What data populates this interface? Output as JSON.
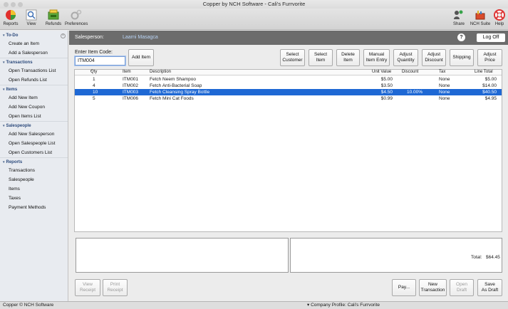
{
  "window": {
    "title": "Copper by NCH Software - Cali's Furrvorite"
  },
  "toolbar": {
    "reports": "Reports",
    "view": "View",
    "refunds": "Refunds",
    "preferences": "Preferences",
    "share": "Share",
    "nch_suite": "NCH Suite",
    "help": "Help"
  },
  "sidebar": {
    "sections": [
      {
        "title": "To-Do",
        "items": [
          "Create an Item",
          "Add a Salesperson"
        ]
      },
      {
        "title": "Transactions",
        "items": [
          "Open Transactions List",
          "Open Refunds List"
        ]
      },
      {
        "title": "Items",
        "items": [
          "Add New Item",
          "Add New Coupon",
          "Open Items List"
        ]
      },
      {
        "title": "Salespeople",
        "items": [
          "Add New Salesperson",
          "Open Salespeople List",
          "Open Customers List"
        ]
      },
      {
        "title": "Reports",
        "items": [
          "Transactions",
          "Salespeople",
          "Items",
          "Taxes",
          "Payment Methods"
        ]
      }
    ]
  },
  "header": {
    "salesperson_label": "Salesperson:",
    "salesperson_name": "Laarni Masagca",
    "help": "?",
    "log_off": "Log Off"
  },
  "entry": {
    "label": "Enter Item Code:",
    "value": "ITM004",
    "add_item": "Add Item"
  },
  "actions": {
    "select_customer": [
      "Select",
      "Customer"
    ],
    "select_item": [
      "Select",
      "Item"
    ],
    "delete_item": [
      "Delete",
      "Item"
    ],
    "manual_entry": [
      "Manual",
      "Item Entry"
    ],
    "adjust_quantity": [
      "Adjust",
      "Quantity"
    ],
    "adjust_discount": [
      "Adjust",
      "Discount"
    ],
    "shipping": "Shipping",
    "adjust_price": [
      "Adjust",
      "Price"
    ]
  },
  "table": {
    "columns": [
      "Qty",
      "Item",
      "Description",
      "Unit Value",
      "Discount",
      "Tax",
      "Line Total"
    ],
    "sort_indicator": "^",
    "rows": [
      {
        "qty": "1",
        "item": "ITM001",
        "description": "Fetch Neem Shampoo",
        "unit_value": "$5.00",
        "discount": "",
        "tax": "None",
        "line_total": "$5.00",
        "selected": false
      },
      {
        "qty": "4",
        "item": "ITM002",
        "description": "Fetch Anti-Bacterial Soap",
        "unit_value": "$3.50",
        "discount": "",
        "tax": "None",
        "line_total": "$14.00",
        "selected": false
      },
      {
        "qty": "10",
        "item": "ITM003",
        "description": "Fetch Cleansing Spray Bottle",
        "unit_value": "$4.50",
        "discount": "10.00%",
        "tax": "None",
        "line_total": "$40.50",
        "selected": true
      },
      {
        "qty": "5",
        "item": "ITM006",
        "description": "Fetch Mini Cat Foods",
        "unit_value": "$0.99",
        "discount": "",
        "tax": "None",
        "line_total": "$4.95",
        "selected": false
      }
    ]
  },
  "totals": {
    "label": "Total:",
    "value": "$64.45"
  },
  "footer_buttons": {
    "view_receipt": [
      "View",
      "Receipt"
    ],
    "print_receipt": [
      "Print",
      "Receipt"
    ],
    "pay": "Pay...",
    "new_transaction": [
      "New",
      "Transaction"
    ],
    "open_draft": [
      "Open",
      "Draft"
    ],
    "save_draft": [
      "Save",
      "As Draft"
    ]
  },
  "status": {
    "left": "Copper © NCH Software",
    "company_profile": "▾ Company Profile: Cali's Furrvorite"
  },
  "colors": {
    "selection": "#1e68d4",
    "header_bar": "#6c6c6c",
    "sidebar_heading": "#2c4a7c"
  }
}
